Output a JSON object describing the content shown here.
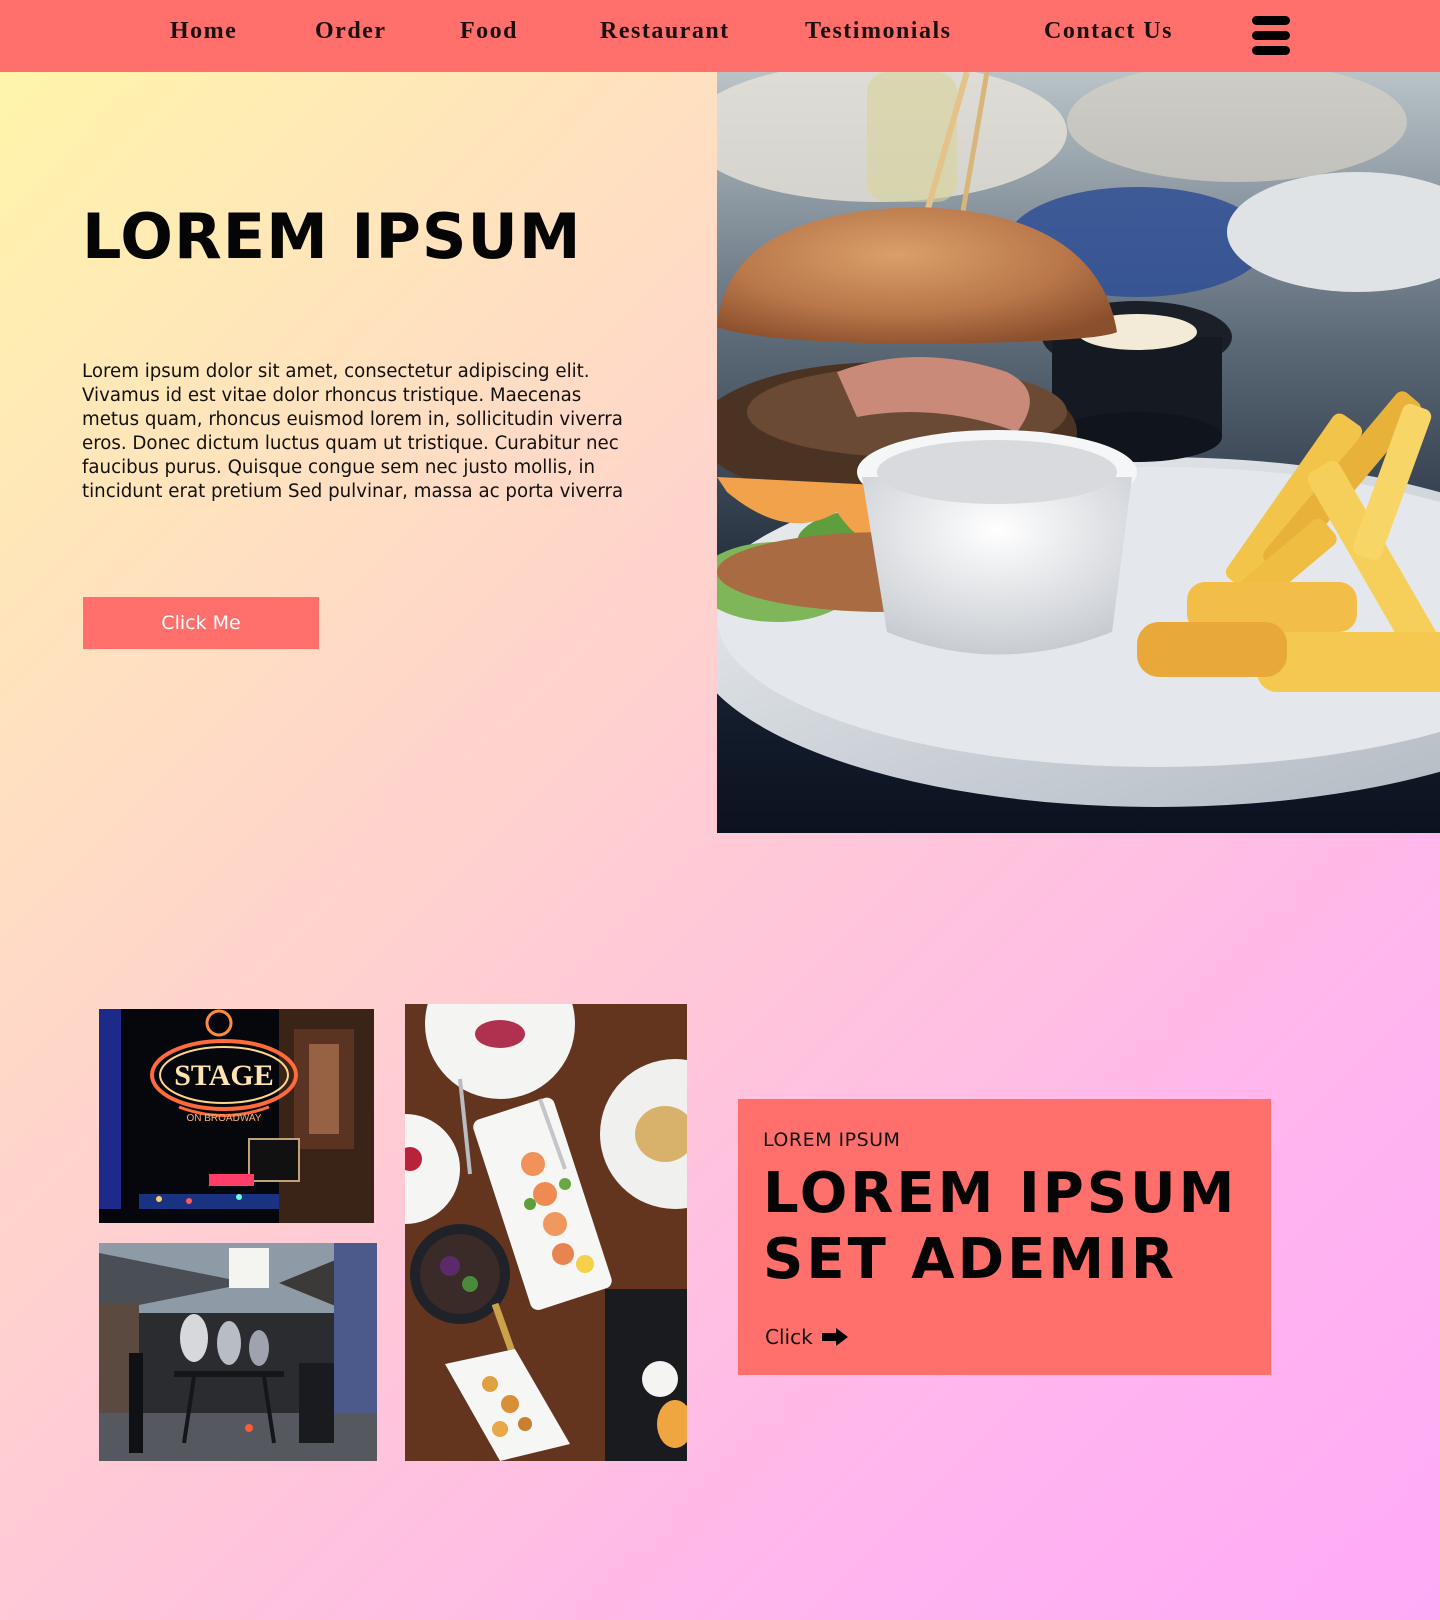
{
  "nav": {
    "items": [
      {
        "label": "Home"
      },
      {
        "label": "Order"
      },
      {
        "label": "Food"
      },
      {
        "label": "Restaurant"
      },
      {
        "label": "Testimonials"
      },
      {
        "label": "Contact Us"
      }
    ],
    "menu_icon": "hamburger-menu-icon"
  },
  "hero": {
    "title": "LOREM IPSUM",
    "body": "Lorem ipsum dolor sit amet, consectetur adipiscing elit. Vivamus id est vitae dolor rhoncus tristique. Maecenas metus quam, rhoncus euismod lorem in, sollicitudin viverra eros. Donec dictum luctus quam ut tristique. Curabitur nec faucibus purus. Quisque congue sem nec justo mollis, in tincidunt erat pretium Sed pulvinar, massa ac porta viverra",
    "button_label": "Click Me"
  },
  "gallery": {
    "sign_text": "STAGE",
    "sign_subtext": "ON BROADWAY"
  },
  "promo": {
    "eyebrow": "LOREM IPSUM",
    "heading_line1": "LOREM IPSUM",
    "heading_line2": "SET ADEMIR",
    "link_label": "Click",
    "link_icon": "arrow-right-icon"
  },
  "colors": {
    "accent": "#ff6f6b",
    "text": "#050505",
    "gradient_start": "#fff7a8",
    "gradient_end": "#ffaaf6"
  }
}
